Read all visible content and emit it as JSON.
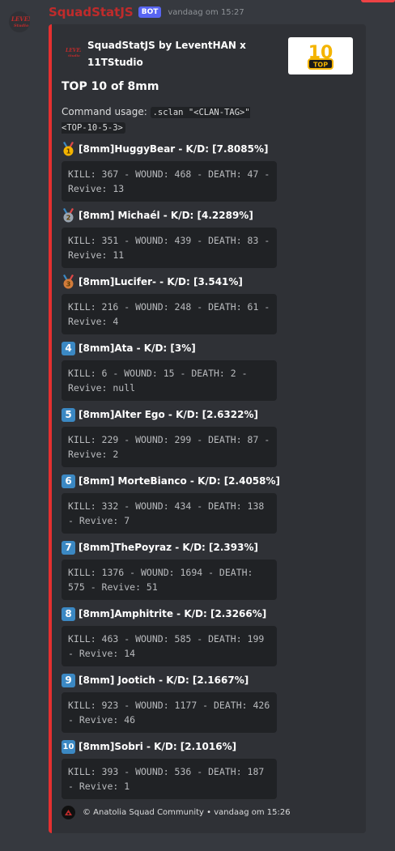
{
  "message": {
    "username": "SquadStatJS",
    "bot_tag": "BOT",
    "timestamp": "vandaag om 15:27",
    "avatar_icon": "leven-logo-icon"
  },
  "embed": {
    "accent_color": "#e53030",
    "author_name": "SquadStatJS by LeventHAN x 11TStudio",
    "thumbnail_icon": "top-10-icon",
    "thumbnail_text": {
      "number": "10",
      "label": "TOP"
    },
    "title": "TOP 10 of 8mm",
    "description_prefix": "Command usage:",
    "description_code": ".sclan \"<CLAN-TAG>\" <TOP-10-5-3>",
    "fields": [
      {
        "rank": "1",
        "icon": "gold-medal-icon",
        "name": "[8mm]HuggyBear - K/D: [7.8085%]",
        "stats": "KILL: 367 - WOUND: 468 - DEATH: 47 - Revive: 13"
      },
      {
        "rank": "2",
        "icon": "silver-medal-icon",
        "name": "[8mm] Michaél - K/D: [4.2289%]",
        "stats": "KILL: 351 - WOUND: 439 - DEATH: 83 - Revive: 11"
      },
      {
        "rank": "3",
        "icon": "bronze-medal-icon",
        "name": "[8mm]Lucifer- - K/D: [3.541%]",
        "stats": "KILL: 216 - WOUND: 248 - DEATH: 61 - Revive: 4"
      },
      {
        "rank": "4",
        "icon": "keycap-4-icon",
        "name": "[8mm]Ata - K/D: [3%]",
        "stats": "KILL: 6 - WOUND: 15 - DEATH: 2 - Revive: null"
      },
      {
        "rank": "5",
        "icon": "keycap-5-icon",
        "name": "[8mm]Alter Ego - K/D: [2.6322%]",
        "stats": "KILL: 229 - WOUND: 299 - DEATH: 87 - Revive: 2"
      },
      {
        "rank": "6",
        "icon": "keycap-6-icon",
        "name": "[8mm] MorteBianco - K/D: [2.4058%]",
        "stats": "KILL: 332 - WOUND: 434 - DEATH: 138 - Revive: 7"
      },
      {
        "rank": "7",
        "icon": "keycap-7-icon",
        "name": "[8mm]ThePoyraz - K/D: [2.393%]",
        "stats": "KILL: 1376 - WOUND: 1694 - DEATH: 575 - Revive: 51"
      },
      {
        "rank": "8",
        "icon": "keycap-8-icon",
        "name": "[8mm]Amphitrite - K/D: [2.3266%]",
        "stats": "KILL: 463 - WOUND: 585 - DEATH: 199 - Revive: 14"
      },
      {
        "rank": "9",
        "icon": "keycap-9-icon",
        "name": "[8mm] Jootich - K/D: [2.1667%]",
        "stats": "KILL: 923 - WOUND: 1177 - DEATH: 426 - Revive: 46"
      },
      {
        "rank": "10",
        "icon": "keycap-10-icon",
        "name": "[8mm]Sobri - K/D: [2.1016%]",
        "stats": "KILL: 393 - WOUND: 536 - DEATH: 187 - Revive: 1"
      }
    ],
    "footer_icon": "anatolia-logo-icon",
    "footer_text": "© Anatolia Squad Community • vandaag om 15:26"
  },
  "colors": {
    "background": "#36393f",
    "embed_bg": "#2f3136",
    "username": "#c02b2b",
    "bot_tag": "#5865f2",
    "keycap": "#3b88c3",
    "gold": "#f4b400",
    "silver": "#9aa5b1",
    "bronze": "#d17b3a",
    "medal_ribbon": "#3b88c3"
  }
}
